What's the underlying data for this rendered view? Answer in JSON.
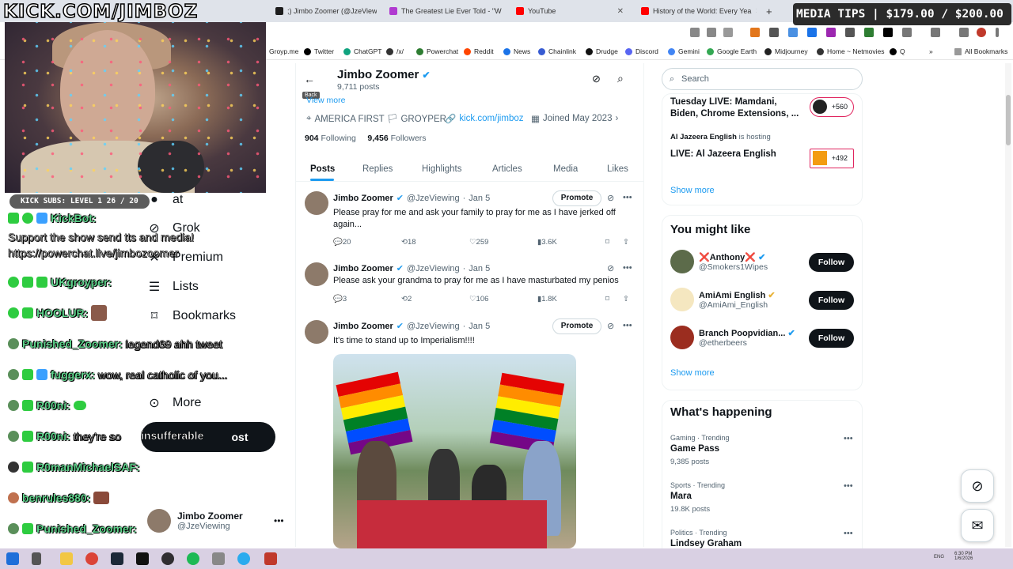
{
  "browser": {
    "tabs": [
      {
        "title": ";) Jimbo Zoomer (@JzeViewi",
        "color": "#1d1d1d"
      },
      {
        "title": "The Greatest Lie Ever Told - \"W",
        "color": "#b03ad0"
      },
      {
        "title": "YouTube",
        "color": "#ff0000"
      },
      {
        "title": "History of the World: Every Yea",
        "color": "#ff0000"
      }
    ],
    "new_tab": "+",
    "bookmarks": [
      {
        "label": "Groyp.me",
        "color": "#3a7bd5"
      },
      {
        "label": "Twitter",
        "color": "#000000"
      },
      {
        "label": "ChatGPT",
        "color": "#10a37f"
      },
      {
        "label": "/x/",
        "color": "#333333"
      },
      {
        "label": "Powerchat",
        "color": "#2e7d32"
      },
      {
        "label": "Reddit",
        "color": "#ff4500"
      },
      {
        "label": "News",
        "color": "#1a73e8"
      },
      {
        "label": "Chainlink",
        "color": "#375bd2"
      },
      {
        "label": "Drudge",
        "color": "#111111"
      },
      {
        "label": "Discord",
        "color": "#5865f2"
      },
      {
        "label": "Gemini",
        "color": "#4285f4"
      },
      {
        "label": "Google Earth",
        "color": "#34a853"
      },
      {
        "label": "Midjourney",
        "color": "#222222"
      },
      {
        "label": "Home ~ Netmovies",
        "color": "#333333"
      },
      {
        "label": "Q",
        "color": "#000000"
      }
    ],
    "all_bookmarks": "All Bookmarks"
  },
  "overlay": {
    "kick_url": "KICK.COM/JIMBOZ",
    "media_tips": "MEDIA TIPS | $179.00 / $200.00",
    "subs": "KICK SUBS: LEVEL 1 26 / 20",
    "support_line1": "Support the show send tts and media!",
    "support_line2": "https://powerchat.live/jimbozoomer",
    "chat": [
      {
        "user": "KickBot:",
        "msg": "",
        "badge": "#2ecc40"
      },
      {
        "user": "UKgroyper:",
        "msg": "",
        "badge": "#2ecc40"
      },
      {
        "user": "HOOLUR:",
        "msg": "",
        "badge": "#2ecc40"
      },
      {
        "user": "Punished_Zoomer:",
        "msg": "legend69 ahh tweet",
        "badge": "#5a8f5a"
      },
      {
        "user": "fuggerx:",
        "msg": "wow, real catholic of you...",
        "badge": "#5a8f5a"
      },
      {
        "user": "R00ni:",
        "msg": "",
        "badge": "#5a8f5a"
      },
      {
        "user": "R00ni:",
        "msg": "they're so",
        "badge": "#5a8f5a"
      },
      {
        "user": "R0manMichaelSAF:",
        "msg": "",
        "badge": "#333333"
      },
      {
        "user": "benrules880:",
        "msg": "",
        "badge": "#c0714f"
      },
      {
        "user": "Punished_Zoomer:",
        "msg": "",
        "badge": "#5a8f5a"
      }
    ],
    "insufferable": "insufferable"
  },
  "xnav": {
    "items": [
      {
        "label": "Grok",
        "icon": "grok-icon"
      },
      {
        "label": "Premium",
        "icon": "x-icon"
      },
      {
        "label": "Lists",
        "icon": "list-icon"
      },
      {
        "label": "Bookmarks",
        "icon": "bookmark-icon"
      },
      {
        "label": "More",
        "icon": "more-icon"
      }
    ],
    "chat_partial": "at",
    "post_label": "ost",
    "account_name": "Jimbo Zoomer",
    "account_handle": "@JzeViewing"
  },
  "profile": {
    "name": "Jimbo Zoomer",
    "posts": "9,711 posts",
    "back_tooltip": "Back",
    "view_more": "View more",
    "location": "AMERICA FIRST 🏳 GROYPER",
    "link": "kick.com/jimboz",
    "joined": "Joined May 2023",
    "following_count": "904",
    "following_label": "Following",
    "followers_count": "9,456",
    "followers_label": "Followers",
    "tabs": [
      "Posts",
      "Replies",
      "Highlights",
      "Articles",
      "Media",
      "Likes"
    ]
  },
  "tweets": [
    {
      "name": "Jimbo Zoomer",
      "handle": "@JzeViewing",
      "date": "Jan 5",
      "text": "Please pray for me and ask your family to pray for me as I have jerked off again...",
      "replies": "20",
      "reposts": "18",
      "likes": "259",
      "views": "3.6K",
      "promote": "Promote"
    },
    {
      "name": "Jimbo Zoomer",
      "handle": "@JzeViewing",
      "date": "Jan 5",
      "text": "Please ask your grandma to pray for me as I have masturbated my penios",
      "replies": "3",
      "reposts": "2",
      "likes": "106",
      "views": "1.8K"
    },
    {
      "name": "Jimbo Zoomer",
      "handle": "@JzeViewing",
      "date": "Jan 5",
      "text": "It's time to stand up to Imperialism!!!!",
      "promote": "Promote"
    }
  ],
  "sidebar": {
    "search_placeholder": "Search",
    "live": [
      {
        "title": "Tuesday LIVE: Mamdani, Biden, Chrome Extensions, ...",
        "count": "+560"
      },
      {
        "host": "Al Jazeera English",
        "hosting": "is hosting",
        "title": "LIVE: Al Jazeera English",
        "count": "+492"
      }
    ],
    "show_more": "Show more",
    "you_might_like": "You might like",
    "suggestions": [
      {
        "name": "❌Anthony❌",
        "handle": "@Smokers1Wipes",
        "button": "Follow"
      },
      {
        "name": "AmiAmi English",
        "handle": "@AmiAmi_English",
        "button": "Follow"
      },
      {
        "name": "Branch Poopvidian...",
        "handle": "@etherbeers",
        "button": "Follow"
      }
    ],
    "whats_happening": "What's happening",
    "trends": [
      {
        "category": "Gaming · Trending",
        "name": "Game Pass",
        "count": "9,385 posts"
      },
      {
        "category": "Sports · Trending",
        "name": "Mara",
        "count": "19.8K posts"
      },
      {
        "category": "Politics · Trending",
        "name": "Lindsey Graham",
        "count": ""
      }
    ]
  },
  "taskbar": {
    "lang": "ENG",
    "time": "6:30 PM",
    "date": "1/6/2026"
  }
}
